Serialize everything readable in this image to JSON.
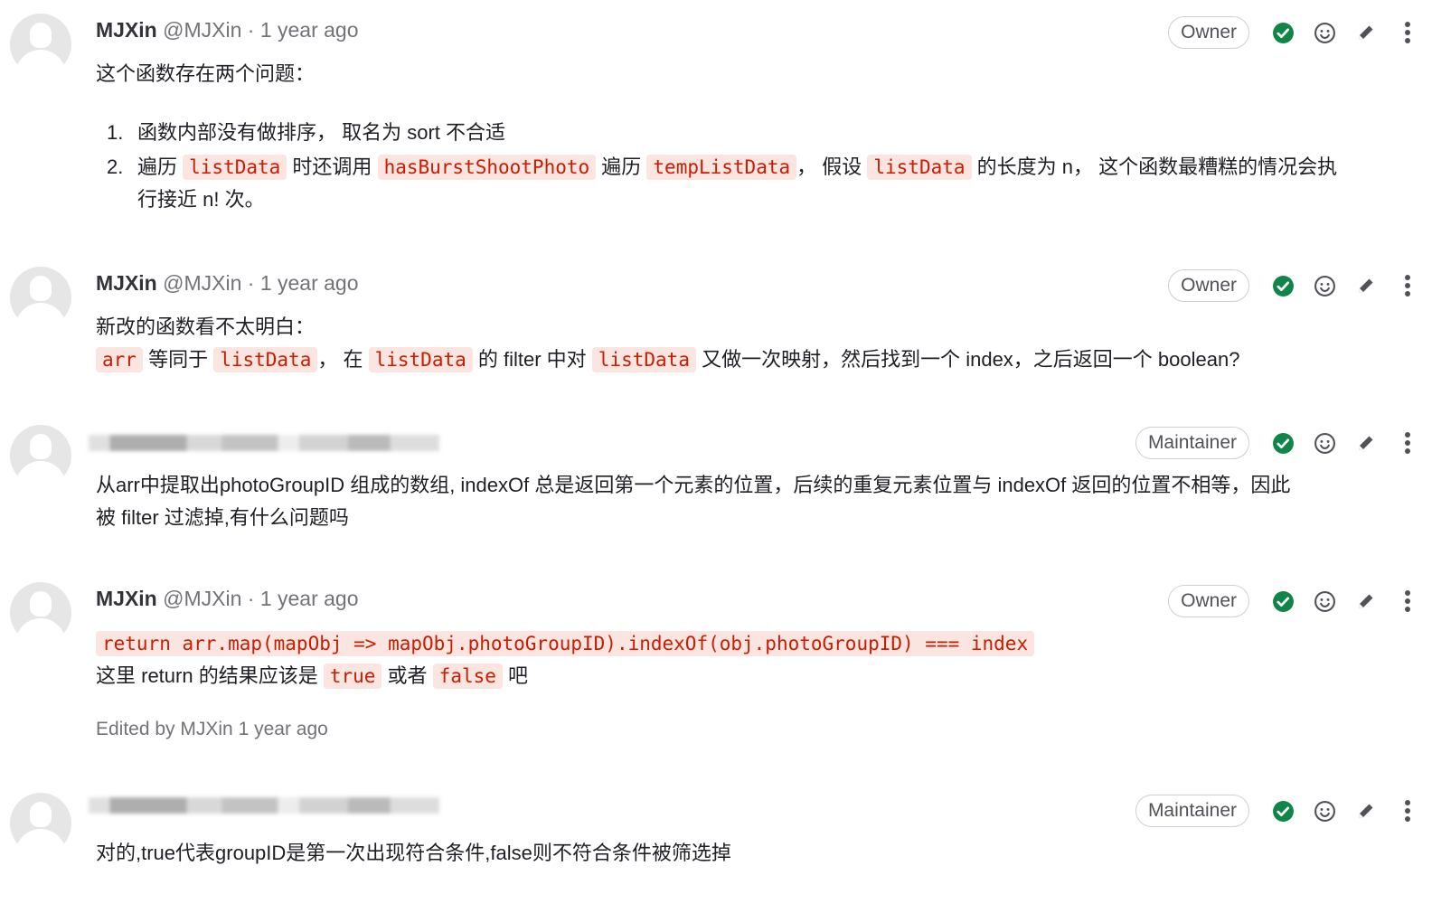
{
  "notes": [
    {
      "author_name": "MJXin",
      "author_meta": "@MJXin · 1 year ago",
      "role": "Owner",
      "intro": "这个函数存在两个问题：",
      "list": [
        {
          "num": "1.",
          "text": "函数内部没有做排序， 取名为 sort 不合适"
        },
        {
          "num": "2.",
          "t1": "遍历",
          "c1": "listData",
          "t2": "时还调用",
          "c2": "hasBurstShootPhoto",
          "t3": "遍历",
          "c3": "tempListData",
          "t4": "， 假设",
          "c4": "listData",
          "t5": "的长度为 n， 这个函数最糟糕的情况会执",
          "cont": "行接近 n! 次。"
        }
      ]
    },
    {
      "author_name": "MJXin",
      "author_meta": "@MJXin · 1 year ago",
      "role": "Owner",
      "line1": "新改的函数看不太明白：",
      "c1": "arr",
      "t1": "等同于",
      "c2": "listData",
      "t2": "， 在",
      "c3": "listData",
      "t3": "的 filter 中对",
      "c4": "listData",
      "t4": "又做一次映射，然后找到一个 index，之后返回一个 boolean?"
    },
    {
      "role": "Maintainer",
      "line1": "从arr中提取出photoGroupID 组成的数组, indexOf 总是返回第一个元素的位置，后续的重复元素位置与 indexOf 返回的位置不相等，因此",
      "line2": "被 filter 过滤掉,有什么问题吗"
    },
    {
      "author_name": "MJXin",
      "author_meta": "@MJXin · 1 year ago",
      "role": "Owner",
      "code": "return arr.map(mapObj => mapObj.photoGroupID).indexOf(obj.photoGroupID) === index",
      "t1": "这里 return 的结果应该是",
      "c1": "true",
      "t2": "或者",
      "c2": "false",
      "t3": "吧",
      "edited": "Edited by MJXin 1 year ago"
    },
    {
      "role": "Maintainer",
      "line1": "对的,true代表groupID是第一次出现符合条件,false则不符合条件被筛选掉"
    }
  ],
  "icons": [
    "resolve-check-icon",
    "emoji-icon",
    "edit-pencil-icon",
    "more-actions-icon"
  ],
  "colors": {
    "accent_green": "#108548",
    "code_red": "#c91c00",
    "code_bg": "#fbe5e1",
    "muted": "#737278"
  }
}
